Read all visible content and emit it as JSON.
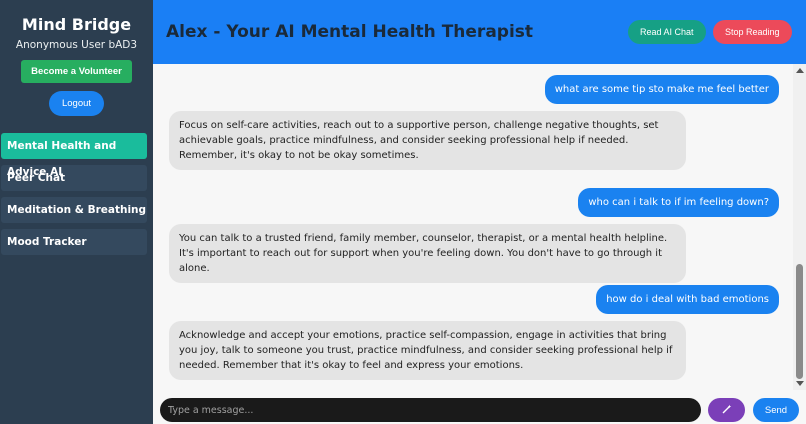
{
  "sidebar": {
    "brand": "Mind Bridge",
    "user": "Anonymous User bAD3",
    "volunteer_label": "Become a Volunteer",
    "logout_label": "Logout",
    "items": [
      {
        "label": "Mental Health and Advice AI",
        "active": true
      },
      {
        "label": "Peer Chat",
        "active": false
      },
      {
        "label": "Meditation & Breathing",
        "active": false
      },
      {
        "label": "Mood Tracker",
        "active": false
      }
    ]
  },
  "header": {
    "title": "Alex - Your AI Mental Health Therapist",
    "read_label": "Read AI Chat",
    "stop_label": "Stop Reading"
  },
  "messages": [
    {
      "role": "user",
      "text": "what are some tip sto make me feel better"
    },
    {
      "role": "ai",
      "text": "Focus on self-care activities, reach out to a supportive person, challenge negative thoughts, set achievable goals, practice mindfulness, and consider seeking professional help if needed. Remember, it's okay to not be okay sometimes."
    },
    {
      "role": "user",
      "text": "who can i talk to if im feeling down?"
    },
    {
      "role": "ai",
      "text": "You can talk to a trusted friend, family member, counselor, therapist, or a mental health helpline. It's important to reach out for support when you're feeling down. You don't have to go through it alone."
    },
    {
      "role": "user",
      "text": "how do i deal with bad emotions"
    },
    {
      "role": "ai",
      "text": "Acknowledge and accept your emotions, practice self-compassion, engage in activities that bring you joy, talk to someone you trust, practice mindfulness, and consider seeking professional help if needed. Remember that it's okay to feel and express your emotions."
    }
  ],
  "composer": {
    "placeholder": "Type a message...",
    "mic_icon": "magic-wand-icon",
    "send_label": "Send"
  },
  "colors": {
    "header": "#1a7ff5",
    "sidebar": "#2c3e50",
    "active_nav": "#1abc9c",
    "user_bubble": "#1a82f0",
    "ai_bubble": "#e4e4e4"
  }
}
